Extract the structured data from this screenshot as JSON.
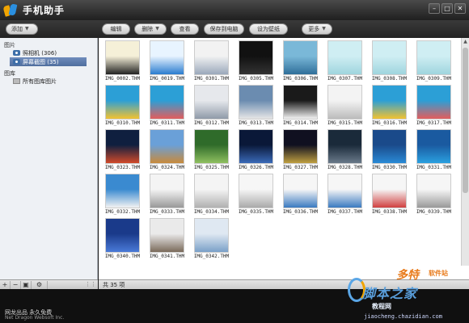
{
  "app": {
    "title": "手机助手"
  },
  "window_controls": {
    "minimize": "–",
    "maximize": "□",
    "close": "✕"
  },
  "toolbar": {
    "add_label": "添加",
    "edit_label": "编辑",
    "delete_label": "删除",
    "view_label": "查看",
    "save_label": "保存到电脑",
    "wallpaper_label": "设为壁纸",
    "more_label": "更多"
  },
  "sidebar": {
    "pictures_header": "图片",
    "items": [
      {
        "label": "照相机 (306)"
      },
      {
        "label": "屏幕截图 (35)"
      }
    ],
    "gallery_header": "图库",
    "gallery_items": [
      {
        "label": "所有图库图片"
      }
    ],
    "bottom_buttons": {
      "add": "+",
      "remove": "−",
      "gear": "⚙"
    }
  },
  "thumbnails": [
    {
      "name": "IMG_0002.THM",
      "colors": [
        "#f5f0d8",
        "#222222"
      ]
    },
    {
      "name": "IMG_0019.THM",
      "colors": [
        "#e8f4ff",
        "#2a7ccf"
      ]
    },
    {
      "name": "IMG_0301.THM",
      "colors": [
        "#f2f2f2",
        "#9aa8bb"
      ]
    },
    {
      "name": "IMG_0305.THM",
      "colors": [
        "#111111",
        "#333333"
      ]
    },
    {
      "name": "IMG_0306.THM",
      "colors": [
        "#7ab8d8",
        "#2f6f9a"
      ]
    },
    {
      "name": "IMG_0307.THM",
      "colors": [
        "#cfeef3",
        "#9fd5de"
      ]
    },
    {
      "name": "IMG_0308.THM",
      "colors": [
        "#cfeef3",
        "#9fd5de"
      ]
    },
    {
      "name": "IMG_0309.THM",
      "colors": [
        "#cfeef3",
        "#9fd5de"
      ]
    },
    {
      "name": "IMG_0310.THM",
      "colors": [
        "#2c9fd6",
        "#f2c230"
      ]
    },
    {
      "name": "IMG_0311.THM",
      "colors": [
        "#2c9fd6",
        "#e35d5d"
      ]
    },
    {
      "name": "IMG_0312.THM",
      "colors": [
        "#e6e8ec",
        "#8f9aa8"
      ]
    },
    {
      "name": "IMG_0313.THM",
      "colors": [
        "#6b8cb0",
        "#e6e6e6"
      ]
    },
    {
      "name": "IMG_0314.THM",
      "colors": [
        "#1a1a1a",
        "#f2f2f2"
      ]
    },
    {
      "name": "IMG_0315.THM",
      "colors": [
        "#f3f3f3",
        "#bbbbbb"
      ]
    },
    {
      "name": "IMG_0316.THM",
      "colors": [
        "#2c9fd6",
        "#f2c230"
      ]
    },
    {
      "name": "IMG_0317.THM",
      "colors": [
        "#2c9fd6",
        "#e35d5d"
      ]
    },
    {
      "name": "IMG_0323.THM",
      "colors": [
        "#0f1f3f",
        "#d24a2a"
      ]
    },
    {
      "name": "IMG_0324.THM",
      "colors": [
        "#6aa0d8",
        "#c88a3a"
      ]
    },
    {
      "name": "IMG_0325.THM",
      "colors": [
        "#2f6b2a",
        "#8fc060"
      ]
    },
    {
      "name": "IMG_0326.THM",
      "colors": [
        "#0a1838",
        "#3a6ab8"
      ]
    },
    {
      "name": "IMG_0327.THM",
      "colors": [
        "#101020",
        "#c0a040"
      ]
    },
    {
      "name": "IMG_0328.THM",
      "colors": [
        "#1a2a3a",
        "#6a7a8a"
      ]
    },
    {
      "name": "IMG_0330.THM",
      "colors": [
        "#1a4a8a",
        "#2a8ad6"
      ]
    },
    {
      "name": "IMG_0331.THM",
      "colors": [
        "#1a5aa0",
        "#2aa0e0"
      ]
    },
    {
      "name": "IMG_0332.THM",
      "colors": [
        "#3a8ad0",
        "#f2f2f2"
      ]
    },
    {
      "name": "IMG_0333.THM",
      "colors": [
        "#f4f4f4",
        "#999999"
      ]
    },
    {
      "name": "IMG_0334.THM",
      "colors": [
        "#f4f4f4",
        "#b0b0b0"
      ]
    },
    {
      "name": "IMG_0335.THM",
      "colors": [
        "#f6f6f6",
        "#aaaaaa"
      ]
    },
    {
      "name": "IMG_0336.THM",
      "colors": [
        "#f6f6f6",
        "#3a7ac0"
      ]
    },
    {
      "name": "IMG_0337.THM",
      "colors": [
        "#f6f6f6",
        "#3a7ac0"
      ]
    },
    {
      "name": "IMG_0338.THM",
      "colors": [
        "#f6f6f6",
        "#d04040"
      ]
    },
    {
      "name": "IMG_0339.THM",
      "colors": [
        "#f6f6f6",
        "#999999"
      ]
    },
    {
      "name": "IMG_0340.THM",
      "colors": [
        "#1a3a8a",
        "#4a7ad8"
      ]
    },
    {
      "name": "IMG_0341.THM",
      "colors": [
        "#eaeaea",
        "#7a6a5a"
      ]
    },
    {
      "name": "IMG_0342.THM",
      "colors": [
        "#dfe8f2",
        "#7aa0c8"
      ]
    }
  ],
  "status": {
    "count_text": "共 35 项"
  },
  "footer": {
    "line1": "网龙出品 永久免费",
    "line2": "Net Dragon Websoft Inc."
  },
  "watermark": {
    "brand_cn": "多特",
    "tagline": "软件站",
    "site_cn": "脚本之家",
    "subtitle": "教程网",
    "url": "jiaocheng.chazidian.com"
  }
}
